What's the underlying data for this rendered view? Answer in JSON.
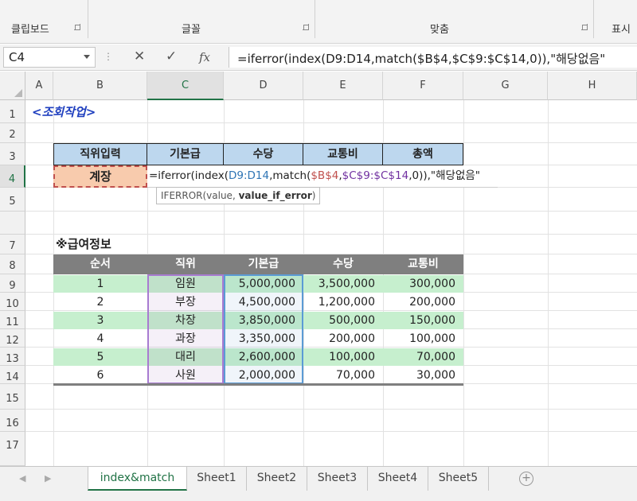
{
  "ribbon": {
    "groups": [
      {
        "label": "클립보드"
      },
      {
        "label": "글꼴"
      },
      {
        "label": "맞춤"
      },
      {
        "label": "표시"
      }
    ]
  },
  "formula_bar": {
    "name_box": "C4",
    "cancel_icon": "✕",
    "enter_icon": "✓",
    "fx_label": "fx",
    "formula": "=iferror(index(D9:D14,match($B$4,$C$9:$C$14,0)),\"해당없음\""
  },
  "columns": [
    "A",
    "B",
    "C",
    "D",
    "E",
    "F",
    "G",
    "H"
  ],
  "selected_column": "C",
  "rows": [
    "1",
    "2",
    "3",
    "4",
    "5",
    "6",
    "7",
    "8",
    "9",
    "10",
    "11",
    "12",
    "13",
    "14",
    "15",
    "16",
    "17"
  ],
  "selected_row": "4",
  "sheet": {
    "title": "<조회작업>",
    "lookup_headers": [
      "직위입력",
      "기본급",
      "수당",
      "교통비",
      "총액"
    ],
    "lookup_input": "계장",
    "cell_formula": {
      "p1": "=iferror(index(",
      "p2": "D9:D14",
      "p3": ",match(",
      "p4": "$B$4",
      "p5": ",",
      "p6": "$C$9:$C$14",
      "p7": ",0)),\"해당없음\""
    },
    "tooltip": {
      "prefix": "IFERROR(value, ",
      "bold": "value_if_error",
      "suffix": ")"
    },
    "pay_title": "※급여정보",
    "pay_headers": [
      "순서",
      "직위",
      "기본급",
      "수당",
      "교통비"
    ],
    "pay_rows": [
      [
        "1",
        "임원",
        "5,000,000",
        "3,500,000",
        "300,000"
      ],
      [
        "2",
        "부장",
        "4,500,000",
        "1,200,000",
        "200,000"
      ],
      [
        "3",
        "차장",
        "3,850,000",
        "500,000",
        "150,000"
      ],
      [
        "4",
        "과장",
        "3,350,000",
        "200,000",
        "100,000"
      ],
      [
        "5",
        "대리",
        "2,600,000",
        "100,000",
        "70,000"
      ],
      [
        "6",
        "사원",
        "2,000,000",
        "70,000",
        "30,000"
      ]
    ]
  },
  "colors": {
    "accent": "#217346",
    "header_blue": "#bdd7ee",
    "band_green": "#c6efce",
    "pay_header": "#7f7f7f",
    "ref_blue": "#2f75b5",
    "ref_purple": "#7030a0",
    "input_fill": "#f8cbad",
    "title_blue": "#1f3fbf"
  },
  "tabs": [
    "index&match",
    "Sheet1",
    "Sheet2",
    "Sheet3",
    "Sheet4",
    "Sheet5"
  ],
  "active_tab": "index&match",
  "add_sheet_icon": "+"
}
